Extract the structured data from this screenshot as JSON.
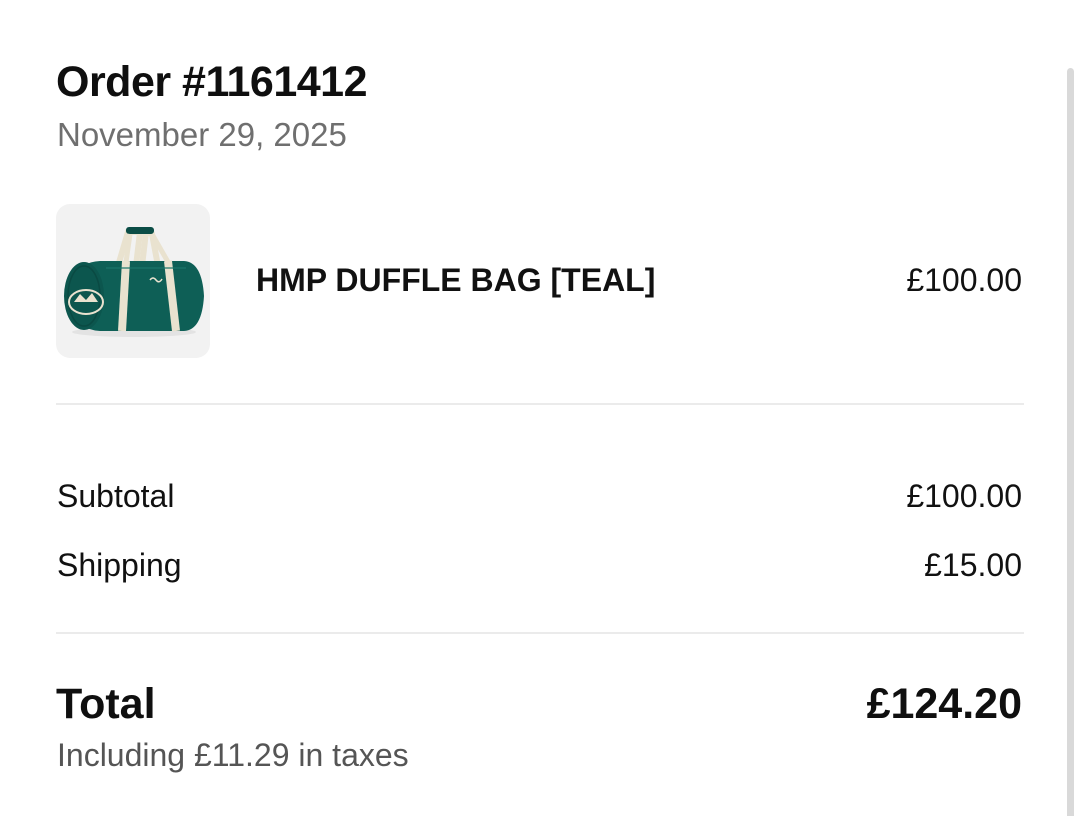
{
  "order": {
    "title": "Order #1161412",
    "date": "November 29, 2025"
  },
  "line_items": [
    {
      "name": "HMP DUFFLE BAG [TEAL]",
      "price": "£100.00",
      "thumbnail_icon": "teal-duffle-bag-image"
    }
  ],
  "summary": {
    "subtotal_label": "Subtotal",
    "subtotal_value": "£100.00",
    "shipping_label": "Shipping",
    "shipping_value": "£15.00"
  },
  "total": {
    "label": "Total",
    "value": "£124.20",
    "taxes_note": "Including £11.29 in taxes"
  },
  "colors": {
    "bag_teal": "#0e5f56",
    "strap_cream": "#e9e2cf",
    "thumb_bg": "#f2f2f2",
    "muted_text": "#6f6f6f",
    "divider": "#ebebeb"
  }
}
